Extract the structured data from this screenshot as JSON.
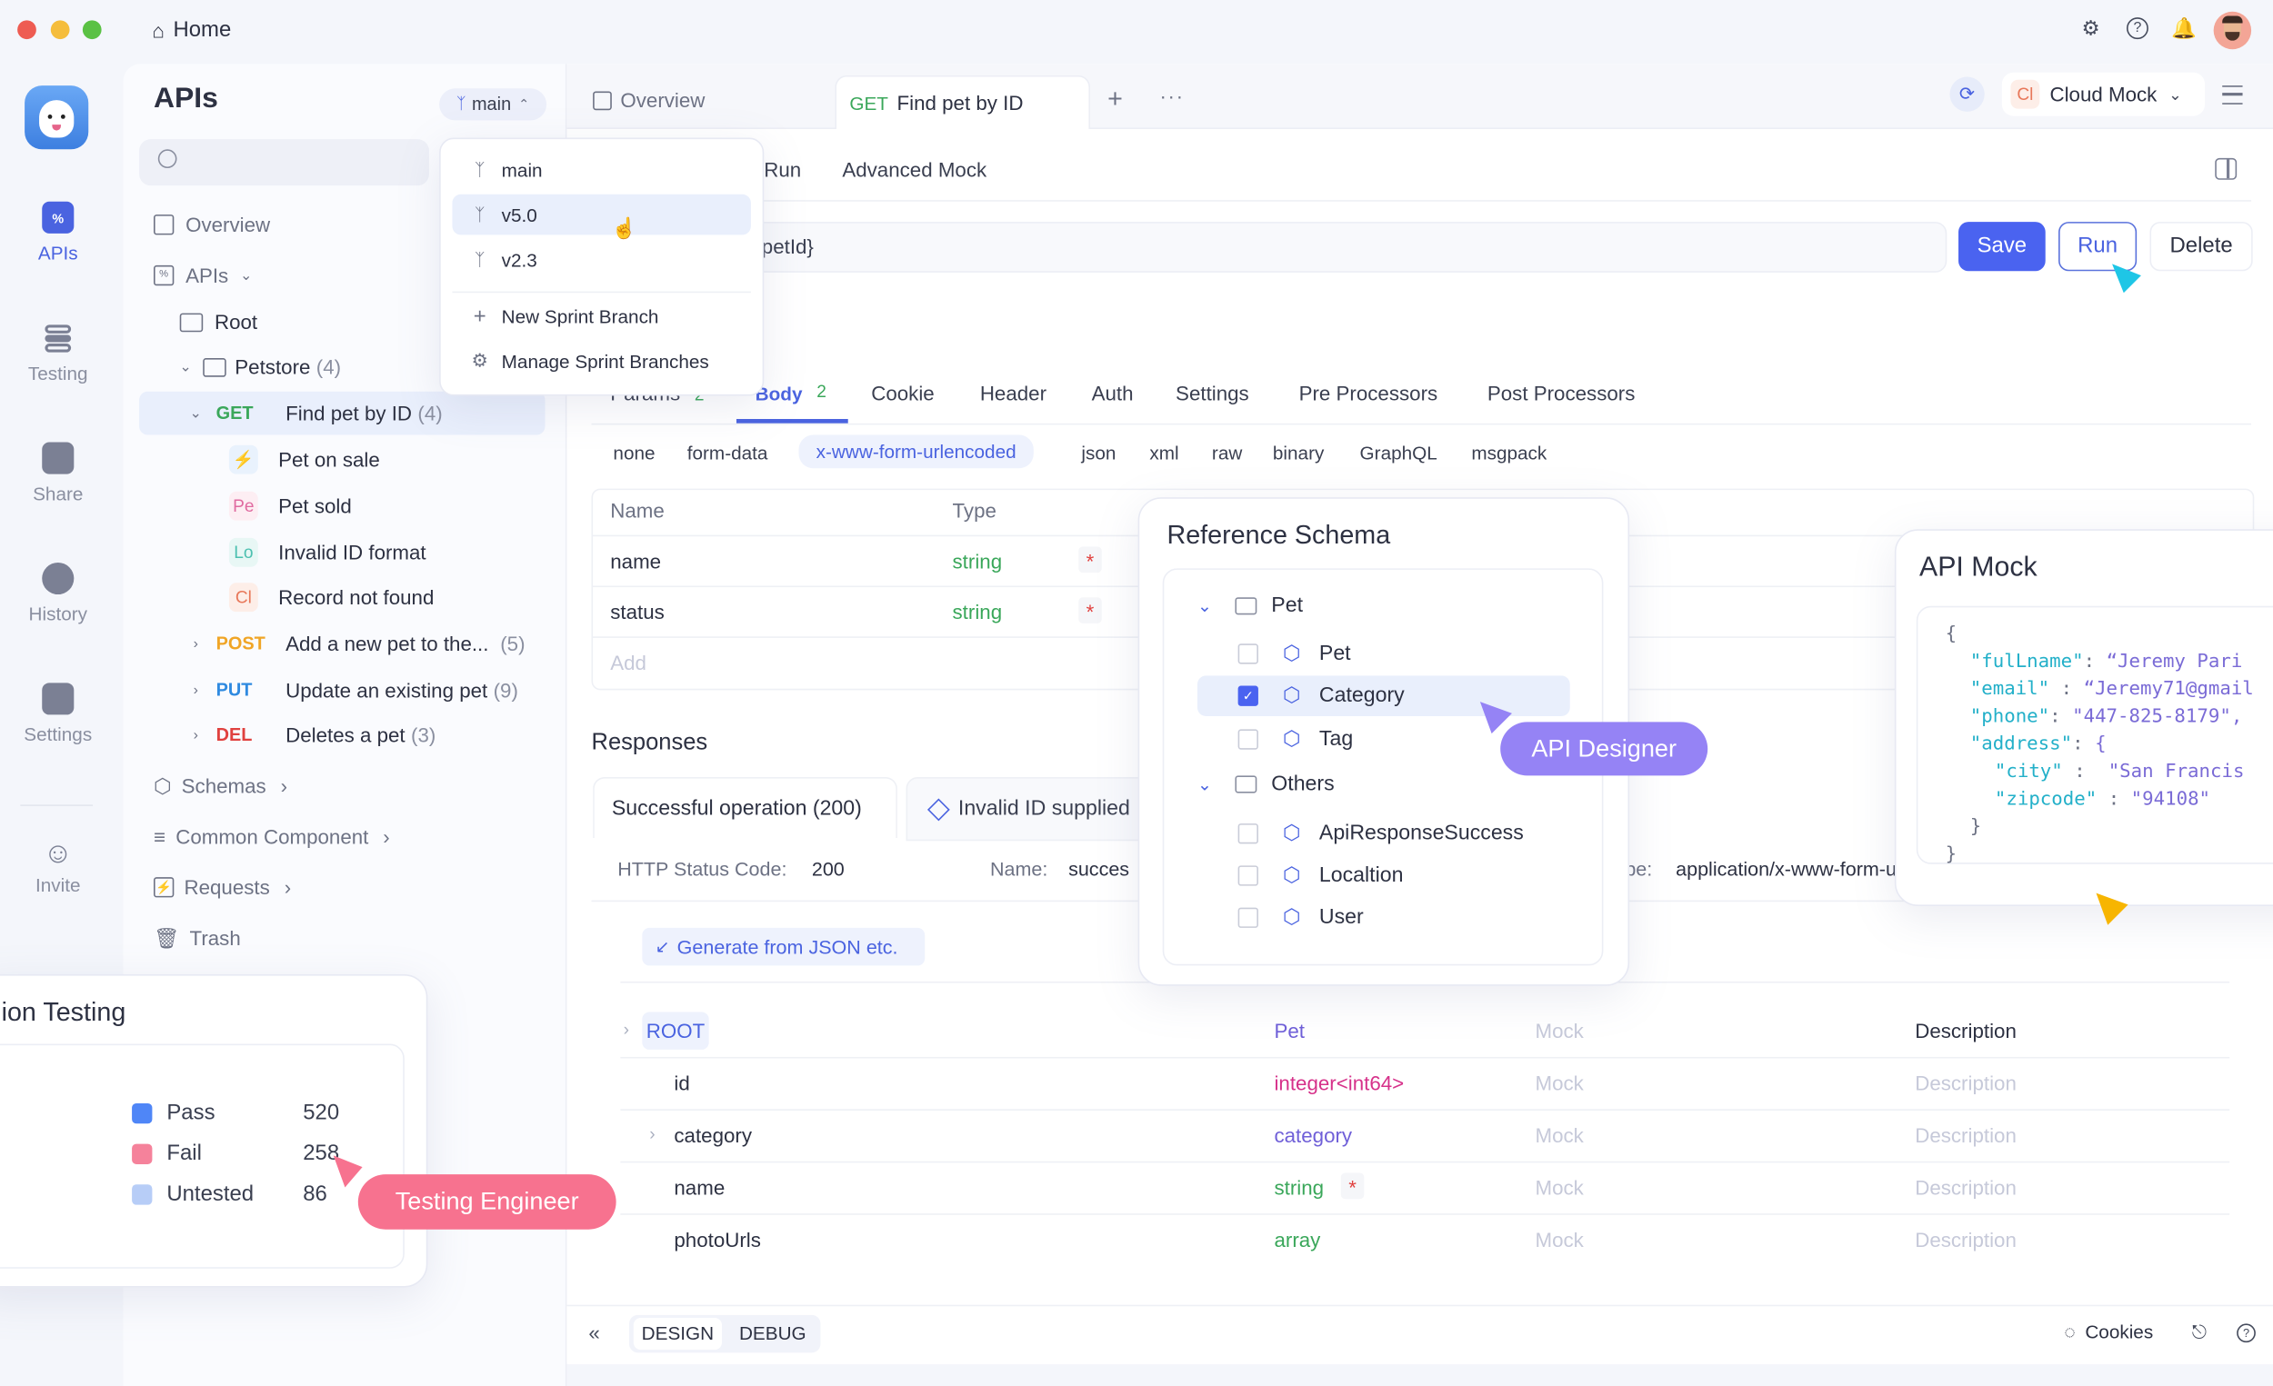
{
  "window": {
    "title": "Home",
    "traffic_lights": [
      "#ee5c52",
      "#f5bd3c",
      "#5ac144"
    ]
  },
  "topbar_icons": [
    "gear-icon",
    "help-icon",
    "bell-icon",
    "avatar"
  ],
  "rail": {
    "items": [
      {
        "label": "APIs",
        "icon": "apis-icon",
        "active": true
      },
      {
        "label": "Testing",
        "icon": "testing-icon",
        "active": false
      },
      {
        "label": "Share",
        "icon": "share-icon",
        "active": false
      },
      {
        "label": "History",
        "icon": "history-icon",
        "active": false
      },
      {
        "label": "Settings",
        "icon": "settings-icon",
        "active": false
      },
      {
        "label": "Invite",
        "icon": "invite-icon",
        "active": false
      }
    ]
  },
  "sidebar": {
    "title": "APIs",
    "branch_button": "main",
    "search_placeholder": "",
    "overview": "Overview",
    "apis": "APIs",
    "root": "Root",
    "petstore": {
      "label": "Petstore",
      "count": "(4)"
    },
    "endpoints": [
      {
        "method": "GET",
        "label": "Find pet by ID",
        "count": "(4)",
        "color": "#3aa75a",
        "expanded": true,
        "selected": true
      },
      {
        "method": "POST",
        "label": "Add a new pet to the...",
        "count": "(5)",
        "color": "#f0a526",
        "expanded": false
      },
      {
        "method": "PUT",
        "label": "Update an existing pet",
        "count": "(9)",
        "color": "#2f8ae0",
        "expanded": false
      },
      {
        "method": "DEL",
        "label": "Deletes a pet",
        "count": "(3)",
        "color": "#e0413f",
        "expanded": false
      }
    ],
    "cases": [
      {
        "badge": "⚡",
        "label": "Pet on sale",
        "bg": "#e9f2fd",
        "fg": "#3b86e0"
      },
      {
        "badge": "Pe",
        "label": "Pet sold",
        "bg": "#fdeef3",
        "fg": "#e06aa0"
      },
      {
        "badge": "Lo",
        "label": "Invalid ID format",
        "bg": "#e8f7f5",
        "fg": "#4dc0b0"
      },
      {
        "badge": "Cl",
        "label": "Record not found",
        "bg": "#fdeee8",
        "fg": "#e8785a"
      }
    ],
    "sections": [
      {
        "label": "Schemas",
        "icon": "cube-icon"
      },
      {
        "label": "Common Component",
        "icon": "layers-icon"
      },
      {
        "label": "Requests",
        "icon": "bolt-icon"
      },
      {
        "label": "Trash",
        "icon": "trash-icon"
      }
    ]
  },
  "branch_menu": {
    "items": [
      "main",
      "v5.0",
      "v2.3"
    ],
    "hovered": "v5.0",
    "actions": [
      {
        "label": "New Sprint Branch",
        "icon": "plus-icon"
      },
      {
        "label": "Manage Sprint Branches",
        "icon": "gear-icon"
      }
    ]
  },
  "tabs": {
    "overview": "Overview",
    "active_method": "GET",
    "active_label": "Find pet by ID",
    "env": {
      "badge": "Cl",
      "label": "Cloud Mock"
    }
  },
  "subtabs": [
    "Run",
    "Advanced Mock"
  ],
  "url": {
    "value": ":/{petId}"
  },
  "actions": {
    "save": "Save",
    "run": "Run",
    "delete": "Delete"
  },
  "request_tabs": [
    {
      "label": "Params",
      "count": "2"
    },
    {
      "label": "Body",
      "count": "2",
      "active": true
    },
    {
      "label": "Cookie"
    },
    {
      "label": "Header"
    },
    {
      "label": "Auth"
    },
    {
      "label": "Settings"
    },
    {
      "label": "Pre Processors"
    },
    {
      "label": "Post Processors"
    }
  ],
  "body_types": [
    "none",
    "form-data",
    "x-www-form-urlencoded",
    "json",
    "xml",
    "raw",
    "binary",
    "GraphQL",
    "msgpack"
  ],
  "body_type_selected": "x-www-form-urlencoded",
  "params_table": {
    "headers": [
      "Name",
      "Type"
    ],
    "rows": [
      {
        "name": "name",
        "type": "string",
        "required": "*"
      },
      {
        "name": "status",
        "type": "string",
        "required": "*"
      }
    ],
    "add_placeholder": "Add"
  },
  "responses": {
    "title": "Responses",
    "tabs": [
      "Successful operation (200)",
      "Invalid ID supplied"
    ],
    "status_label": "HTTP Status Code:",
    "status_value": "200",
    "name_label": "Name:",
    "name_value": "succes",
    "content_type_label": "pe:",
    "content_type_value": "application/x-www-form-u",
    "generate_button": "Generate from JSON etc.",
    "schema_rows": [
      {
        "name": "ROOT",
        "type": "Pet",
        "mock": "Mock",
        "desc": "Description",
        "type_color": "#6f5fd8",
        "root": true
      },
      {
        "name": "id",
        "type": "integer<int64>",
        "mock": "Mock",
        "desc": "Description",
        "type_color": "#d6318a"
      },
      {
        "name": "category",
        "type": "category",
        "mock": "Mock",
        "desc": "Description",
        "type_color": "#6f5fd8",
        "expandable": true
      },
      {
        "name": "name",
        "type": "string",
        "mock": "Mock",
        "desc": "Description",
        "type_color": "#3aa75a",
        "required": "*"
      },
      {
        "name": "photoUrls",
        "type": "array",
        "mock": "Mock",
        "desc": "Description",
        "type_color": "#3aa75a"
      }
    ]
  },
  "reference_schema": {
    "title": "Reference Schema",
    "groups": [
      {
        "label": "Pet",
        "items": [
          {
            "label": "Pet",
            "checked": false
          },
          {
            "label": "Category",
            "checked": true
          },
          {
            "label": "Tag",
            "checked": false
          }
        ]
      },
      {
        "label": "Others",
        "items": [
          {
            "label": "ApiResponseSuccess",
            "checked": false
          },
          {
            "label": "Localtion",
            "checked": false
          },
          {
            "label": "User",
            "checked": false
          }
        ]
      }
    ]
  },
  "api_mock": {
    "title": "API Mock",
    "lines": [
      {
        "indent": 0,
        "key": "",
        "val": "{"
      },
      {
        "indent": 1,
        "key": "\"fulLname\"",
        "sep": ": ",
        "val": "“Jeremy Pari"
      },
      {
        "indent": 1,
        "key": "\"email\"",
        "sep": " : ",
        "val": "“Jeremy71@gmail"
      },
      {
        "indent": 1,
        "key": "\"phone\"",
        "sep": ": ",
        "val": "\"447-825-8179\","
      },
      {
        "indent": 1,
        "key": "\"address\"",
        "sep": ": ",
        "val": "{"
      },
      {
        "indent": 2,
        "key": "\"city\"",
        "sep": " :  ",
        "val": "\"San Francis"
      },
      {
        "indent": 2,
        "key": "\"zipcode\"",
        "sep": " : ",
        "val": "\"94108\""
      },
      {
        "indent": 1,
        "key": "",
        "val": "}"
      },
      {
        "indent": 0,
        "key": "",
        "val": "}"
      }
    ]
  },
  "testing_card": {
    "title": "ion Testing",
    "legend": [
      {
        "label": "Pass",
        "value": "520",
        "color": "#4f86f7"
      },
      {
        "label": "Fail",
        "value": "258",
        "color": "#f5829b"
      },
      {
        "label": "Untested",
        "value": "86",
        "color": "#b7cdf7"
      }
    ]
  },
  "personas": {
    "testing": {
      "label": "Testing Engineer",
      "color": "#f7728f"
    },
    "designer": {
      "label": "API Designer",
      "color": "#9583f5"
    },
    "run_cursor_color": "#1ec6e6",
    "mock_cursor_color": "#f7b500"
  },
  "footer": {
    "modes": [
      "DESIGN",
      "DEBUG"
    ],
    "active_mode": "DESIGN",
    "cookies": "Cookies"
  }
}
